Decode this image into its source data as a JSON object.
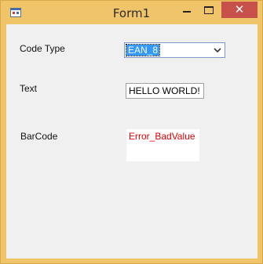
{
  "window": {
    "title": "Form1",
    "close_glyph": "✕",
    "icons": {
      "app": "form-app-icon",
      "minimize": "minimize-icon",
      "maximize": "maximize-icon",
      "close": "close-icon",
      "dropdown": "chevron-down-icon"
    }
  },
  "form": {
    "code_type_label": "Code Type",
    "code_type_value": "EAN_8",
    "text_label": "Text",
    "text_value": "HELLO WORLD!",
    "barcode_label": "BarCode",
    "barcode_output": "Error_BadValue"
  },
  "colors": {
    "frame": "#f0c468",
    "close_button": "#c7504a",
    "client_background": "#f0f0f0",
    "selection": "#3399ff",
    "error_text": "#e00000"
  }
}
